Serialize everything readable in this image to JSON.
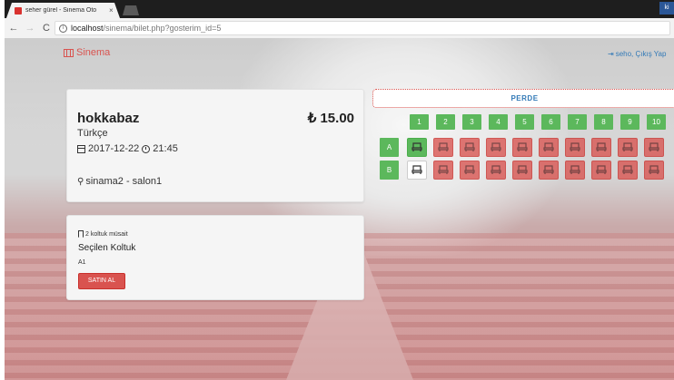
{
  "browser": {
    "tab_title": "seher gürel - Sinema Oto",
    "tab_close": "×",
    "profile_initial": "ki",
    "nav": {
      "back": "←",
      "forward": "→",
      "reload": "C"
    },
    "url_host": "localhost",
    "url_path": "/sinema/bilet.php?gosterim_id=5"
  },
  "header": {
    "brand": "Sinema",
    "user_link": "seho, Çıkış Yap"
  },
  "movie": {
    "title": "hokkabaz",
    "price": "₺ 15.00",
    "language": "Türkçe",
    "date": "2017-12-22",
    "time": "21:45",
    "hall": "sinama2 - salon1"
  },
  "selection": {
    "available_text": "2 koltuk müsait",
    "label": "Seçilen Koltuk",
    "seat": "A1",
    "buy_button": "SATIN AL"
  },
  "seatmap": {
    "screen_label": "PERDE",
    "columns": [
      "1",
      "2",
      "3",
      "4",
      "5",
      "6",
      "7",
      "8",
      "9",
      "10"
    ],
    "rows": [
      {
        "label": "A",
        "seats": [
          "selected",
          "occupied",
          "occupied",
          "occupied",
          "occupied",
          "occupied",
          "occupied",
          "occupied",
          "occupied",
          "occupied"
        ]
      },
      {
        "label": "B",
        "seats": [
          "available",
          "occupied",
          "occupied",
          "occupied",
          "occupied",
          "occupied",
          "occupied",
          "occupied",
          "occupied",
          "occupied"
        ]
      }
    ]
  },
  "colors": {
    "brand_red": "#d9534f",
    "green": "#5cb85c",
    "link_blue": "#337ab7"
  }
}
